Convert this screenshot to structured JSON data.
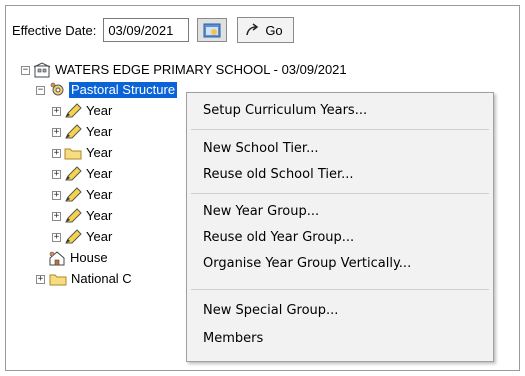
{
  "toolbar": {
    "effective_label": "Effective Date:",
    "date_value": "03/09/2021",
    "go_label": "Go"
  },
  "tree": {
    "root": "WATERS EDGE PRIMARY SCHOOL - 03/09/2021",
    "pastoral": "Pastoral Structure",
    "years": [
      "Year",
      "Year",
      "Year",
      "Year",
      "Year",
      "Year",
      "Year"
    ],
    "house": "House",
    "national": "National C"
  },
  "context_menu": {
    "items": [
      "Setup Curriculum Years...",
      "New School Tier...",
      "Reuse old School Tier...",
      "New Year Group...",
      "Reuse old Year Group...",
      "Organise Year Group Vertically...",
      "New Special Group...",
      "Members"
    ]
  },
  "colors": {
    "selection": "#0a64d8",
    "menu_bg": "#f2f2f2"
  }
}
